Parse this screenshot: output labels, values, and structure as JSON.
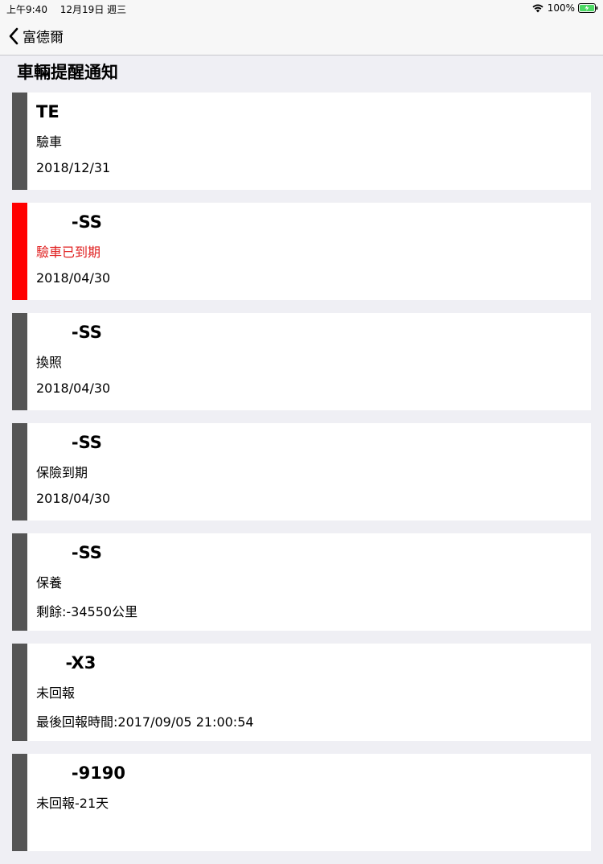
{
  "status_bar": {
    "time": "上午9:40",
    "date": "12月19日 週三",
    "battery": "100%"
  },
  "nav": {
    "back_label": "富德爾"
  },
  "page": {
    "title": "車輛提醒通知"
  },
  "items": [
    {
      "plate": "TE",
      "status": "驗車",
      "detail": "2018/12/31",
      "alert": false
    },
    {
      "plate": "      -SS",
      "status": "驗車已到期",
      "detail": "2018/04/30",
      "alert": true
    },
    {
      "plate": "      -SS",
      "status": "換照",
      "detail": "2018/04/30",
      "alert": false
    },
    {
      "plate": "      -SS",
      "status": "保險到期",
      "detail": "2018/04/30",
      "alert": false
    },
    {
      "plate": "      -SS",
      "status": "保養",
      "detail": "剩餘:-34550公里",
      "alert": false
    },
    {
      "plate": "     -X3",
      "status": "未回報",
      "detail": "最後回報時間:2017/09/05 21:00:54",
      "alert": false
    },
    {
      "plate": "      -9190",
      "status": "未回報-21天",
      "detail": "",
      "alert": false
    }
  ],
  "colors": {
    "stripe_default": "#555555",
    "stripe_alert": "#ff0000",
    "alert_text": "#e02020"
  }
}
